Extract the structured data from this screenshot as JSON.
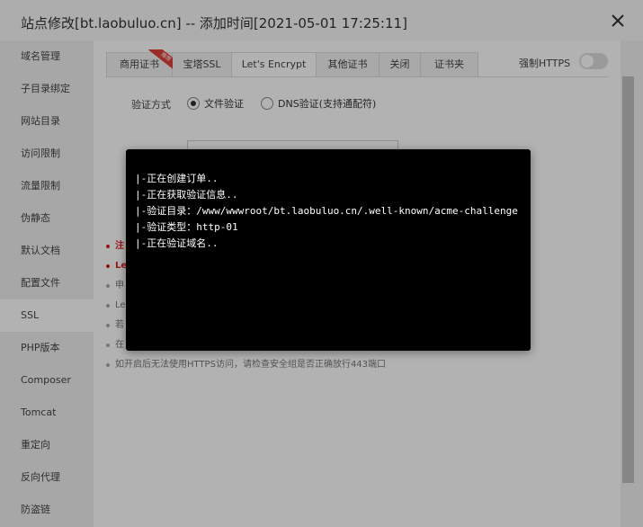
{
  "window": {
    "title": "站点修改[bt.laobuluo.cn] -- 添加时间[2021-05-01 17:25:11]",
    "close_icon": "close-icon"
  },
  "sidebar": {
    "items": [
      {
        "label": "域名管理"
      },
      {
        "label": "子目录绑定"
      },
      {
        "label": "网站目录"
      },
      {
        "label": "访问限制"
      },
      {
        "label": "流量限制"
      },
      {
        "label": "伪静态"
      },
      {
        "label": "默认文档"
      },
      {
        "label": "配置文件"
      },
      {
        "label": "SSL",
        "active": true
      },
      {
        "label": "PHP版本"
      },
      {
        "label": "Composer"
      },
      {
        "label": "Tomcat"
      },
      {
        "label": "重定向"
      },
      {
        "label": "反向代理"
      },
      {
        "label": "防盗链"
      }
    ]
  },
  "ssl": {
    "tabs": [
      {
        "label": "商用证书",
        "badge": "推荐"
      },
      {
        "label": "宝塔SSL"
      },
      {
        "label": "Let's Encrypt",
        "active": true
      },
      {
        "label": "其他证书"
      },
      {
        "label": "关闭"
      },
      {
        "label": "证书夹"
      }
    ],
    "force_https_label": "强制HTTPS",
    "force_https_enabled": false,
    "verify_method_label": "验证方式",
    "options": [
      {
        "label": "文件验证",
        "checked": true
      },
      {
        "label": "DNS验证(支持通配符)",
        "checked": false
      }
    ],
    "notes": [
      {
        "text": "注",
        "style": "red"
      },
      {
        "text": "Le",
        "style": "red"
      },
      {
        "text": "申",
        "style": "normal"
      },
      {
        "text": "Le",
        "style": "normal"
      },
      {
        "text": "若",
        "style": "normal"
      },
      {
        "text": "在",
        "style": "normal"
      },
      {
        "text": "如开启后无法使用HTTPS访问，请检查安全组是否正确放行443端口",
        "style": "normal"
      }
    ]
  },
  "console": {
    "lines": [
      "|-正在创建订单..",
      "|-正在获取验证信息..",
      "|-验证目录：/www/wwwroot/bt.laobuluo.cn/.well-known/acme-challenge",
      "|-验证类型：http-01",
      "|-正在验证域名.."
    ]
  },
  "colors": {
    "console_bg": "#000000",
    "note_red": "#d9201f"
  }
}
